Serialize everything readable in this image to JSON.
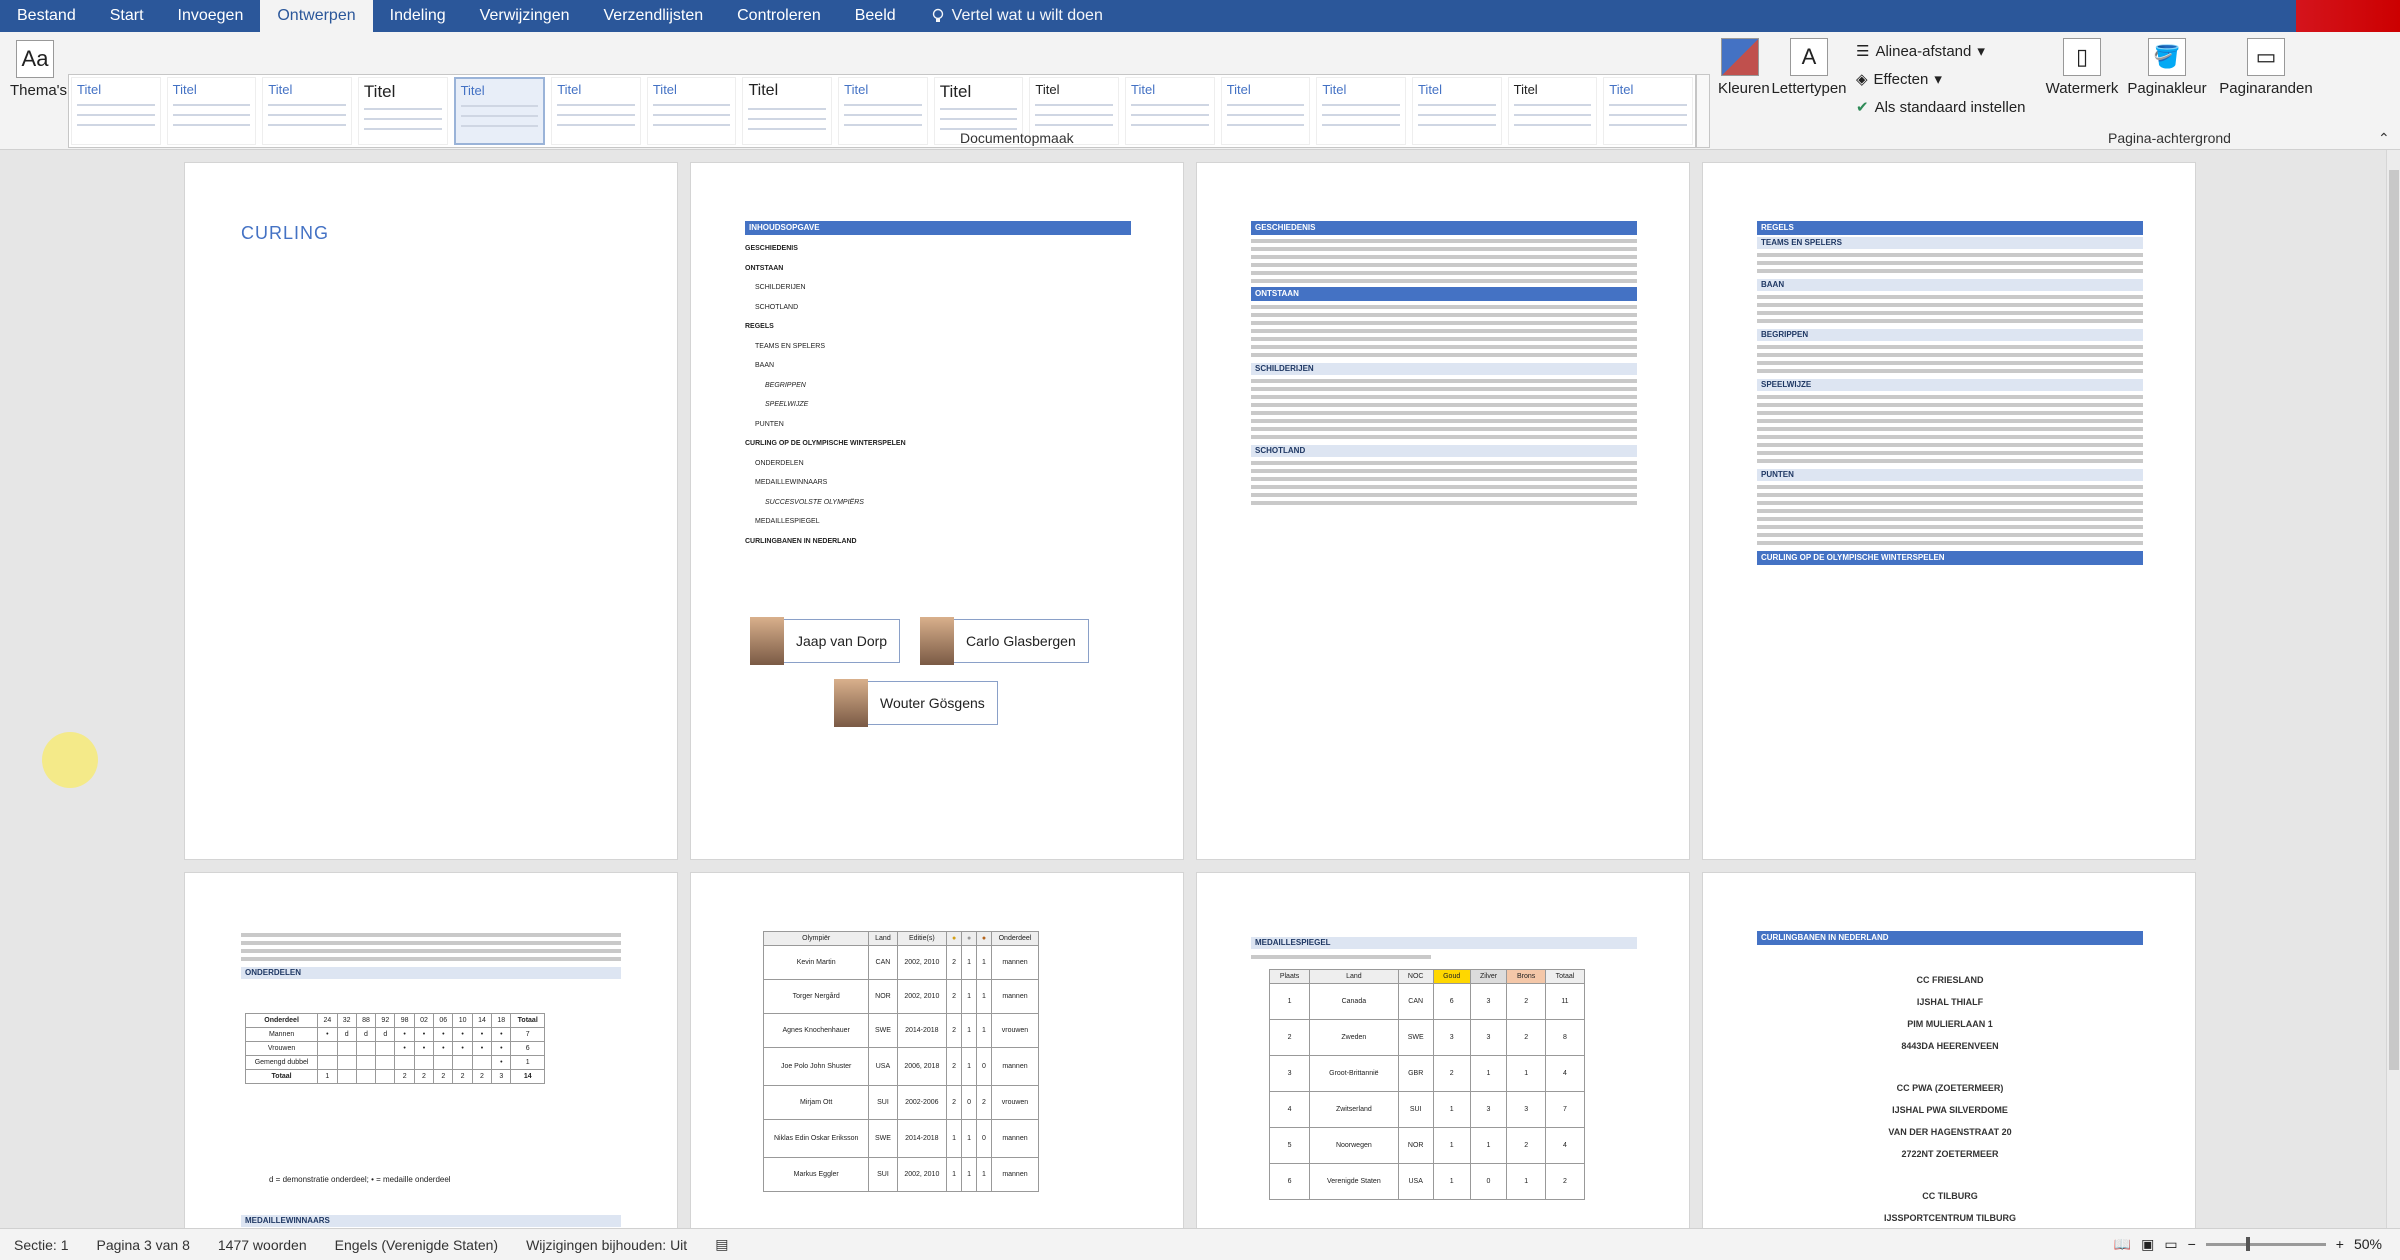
{
  "tabs": [
    "Bestand",
    "Start",
    "Invoegen",
    "Ontwerpen",
    "Indeling",
    "Verwijzingen",
    "Verzendlijsten",
    "Controleren",
    "Beeld"
  ],
  "active_tab": "Ontwerpen",
  "tell_me": "Vertel wat u wilt doen",
  "ribbon": {
    "themes": "Thema's",
    "style_title": "Titel",
    "kleuren": "Kleuren",
    "lettertypen": "Lettertypen",
    "alinea": "Alinea-afstand",
    "effecten": "Effecten",
    "standaard": "Als standaard instellen",
    "watermerk": "Watermerk",
    "paginakleur": "Paginakleur",
    "paginaranden": "Paginaranden",
    "group_doc": "Documentopmaak",
    "group_bg": "Pagina-achtergrond"
  },
  "doc": {
    "cover_title": "CURLING",
    "toc_title": "INHOUDSOPGAVE",
    "toc": [
      "GESCHIEDENIS",
      "ONTSTAAN",
      "SCHILDERIJEN",
      "SCHOTLAND",
      "REGELS",
      "TEAMS EN SPELERS",
      "BAAN",
      "BEGRIPPEN",
      "SPEELWIJZE",
      "PUNTEN",
      "CURLING OP DE OLYMPISCHE WINTERSPELEN",
      "ONDERDELEN",
      "MEDAILLEWINNAARS",
      "SUCCESVOLSTE OLYMPIËRS",
      "MEDAILLESPIEGEL",
      "CURLINGBANEN IN NEDERLAND"
    ],
    "org": [
      "Jaap van Dorp",
      "Carlo Glasbergen",
      "Wouter Gösgens"
    ],
    "p3": [
      "GESCHIEDENIS",
      "ONTSTAAN",
      "SCHILDERIJEN",
      "SCHOTLAND"
    ],
    "p4": [
      "REGELS",
      "TEAMS EN SPELERS",
      "BAAN",
      "BEGRIPPEN",
      "SPEELWIJZE",
      "PUNTEN",
      "CURLING OP DE OLYMPISCHE WINTERSPELEN"
    ],
    "p5_heading": "ONDERDELEN",
    "p5_legend": "d = demonstratie onderdeel; • = medaille onderdeel",
    "p5_footer": "MEDAILLEWINNAARS",
    "p5_rows": [
      "Onderdeel",
      "Mannen",
      "Vrouwen",
      "Gemengd dubbel",
      "Totaal"
    ],
    "p6_head": [
      "Olympiër",
      "Land",
      "Editie(s)",
      "Onderdeel"
    ],
    "p6_rows": [
      [
        "Kevin Martin",
        "CAN",
        "2002, 2010",
        "mannen"
      ],
      [
        "Torger Nergård",
        "NOR",
        "2002, 2010",
        "mannen"
      ],
      [
        "Agnes Knochenhauer",
        "SWE",
        "2014-2018",
        "vrouwen"
      ],
      [
        "Joe Polo John Shuster",
        "USA",
        "2006, 2018",
        "mannen"
      ],
      [
        "Mirjam Ott",
        "SUI",
        "2002-2006",
        "vrouwen"
      ],
      [
        "Niklas Edin Oskar Eriksson",
        "SWE",
        "2014-2018",
        "mannen"
      ],
      [
        "Markus Eggler",
        "SUI",
        "2002, 2010",
        "mannen"
      ]
    ],
    "p7_title": "MEDAILLESPIEGEL",
    "p7_head": [
      "Plaats",
      "Land",
      "NOC",
      "Goud",
      "Zilver",
      "Brons",
      "Totaal"
    ],
    "p7_rows": [
      [
        "1",
        "Canada",
        "CAN",
        "6",
        "3",
        "2",
        "11"
      ],
      [
        "2",
        "Zweden",
        "SWE",
        "3",
        "3",
        "2",
        "8"
      ],
      [
        "3",
        "Groot-Brittannië",
        "GBR",
        "2",
        "1",
        "1",
        "4"
      ],
      [
        "4",
        "Zwitserland",
        "SUI",
        "1",
        "3",
        "3",
        "7"
      ],
      [
        "5",
        "Noorwegen",
        "NOR",
        "1",
        "1",
        "2",
        "4"
      ],
      [
        "6",
        "Verenigde Staten",
        "USA",
        "1",
        "0",
        "1",
        "2"
      ]
    ],
    "p8_title": "CURLINGBANEN IN NEDERLAND",
    "p8_lines": [
      "CC FRIESLAND",
      "IJSHAL THIALF",
      "PIM MULIERLAAN 1",
      "8443DA HEERENVEEN",
      "",
      "CC PWA (ZOETERMEER)",
      "IJSHAL PWA SILVERDOME",
      "VAN DER HAGENSTRAAT 20",
      "2722NT ZOETERMEER",
      "",
      "CC TILBURG",
      "IJSSPORTCENTRUM TILBURG"
    ]
  },
  "status": {
    "sectie": "Sectie: 1",
    "pagina": "Pagina 3 van 8",
    "woorden": "1477 woorden",
    "taal": "Engels (Verenigde Staten)",
    "wijzigingen": "Wijzigingen bijhouden: Uit",
    "zoom": "50%"
  }
}
